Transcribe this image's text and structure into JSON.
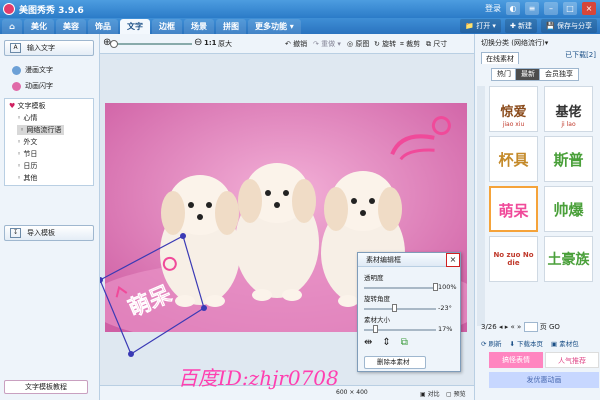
{
  "app": {
    "title": "美图秀秀 3.9.6",
    "login": "登录"
  },
  "nav": {
    "tabs": [
      "美化",
      "美容",
      "饰品",
      "文字",
      "边框",
      "场景",
      "拼图",
      "更多功能"
    ],
    "active": "文字",
    "open": "打开",
    "new": "新建",
    "save": "保存与分享"
  },
  "toolbar": {
    "ratio": "1:1",
    "original": "原大",
    "undo": "撤销",
    "redo": "重做",
    "restore": "原图",
    "rotate": "旋转",
    "crop": "裁剪",
    "size": "尺寸"
  },
  "left": {
    "input_text": "输入文字",
    "comic_text": "漫画文字",
    "animated_text": "动画闪字",
    "template_head": "文字模板",
    "template_items": [
      "心情",
      "网络流行语",
      "外文",
      "节日",
      "日历",
      "其他"
    ],
    "selected_item": "网络流行语",
    "import_button": "导入模板",
    "tutorial": "文字模板教程"
  },
  "dialog": {
    "title": "素材编辑框",
    "transparency_label": "透明度",
    "transparency_value": "100%",
    "transparency": 1.0,
    "rotation_label": "旋转角度",
    "rotation_value": "-23°",
    "rotation": -23,
    "size_label": "素材大小",
    "size_value": "17%",
    "size": 0.17,
    "delete_button": "删除本素材"
  },
  "right": {
    "category_label": "切换分类",
    "category_value": "网络流行",
    "tabs": [
      "在线素材",
      "已下载"
    ],
    "download_count": "已下载[2]",
    "subtabs": [
      "热门",
      "最新",
      "会员独享"
    ],
    "active_subtab": "最新",
    "tiles": [
      {
        "text": "惊爱",
        "sub": "jiao xiu"
      },
      {
        "text": "基佬",
        "sub": "ji lao"
      },
      {
        "text": "杯具",
        "sub": ""
      },
      {
        "text": "斯普",
        "sub": ""
      },
      {
        "text": "萌呆",
        "sub": ""
      },
      {
        "text": "帅爆",
        "sub": ""
      },
      {
        "text": "No zuo No die",
        "sub": ""
      },
      {
        "text": "土豪族",
        "sub": ""
      }
    ],
    "page_info": "3/26",
    "page_go": "页",
    "refresh": "刷新",
    "download_page": "下载本页",
    "material_pack": "素材包",
    "thumb_1": "搞怪表情",
    "thumb_2": "人气推荐",
    "thumb_3": "发优惠动画"
  },
  "canvas": {
    "dimensions": "600 × 400",
    "compare": "对比",
    "preview": "预览",
    "sticker_text": "萌呆"
  },
  "watermark": "百度ID:zhjr0708",
  "colors": {
    "accent": "#2b7bc8",
    "pink": "#d97db5",
    "watermark": "#ff3fb0"
  }
}
